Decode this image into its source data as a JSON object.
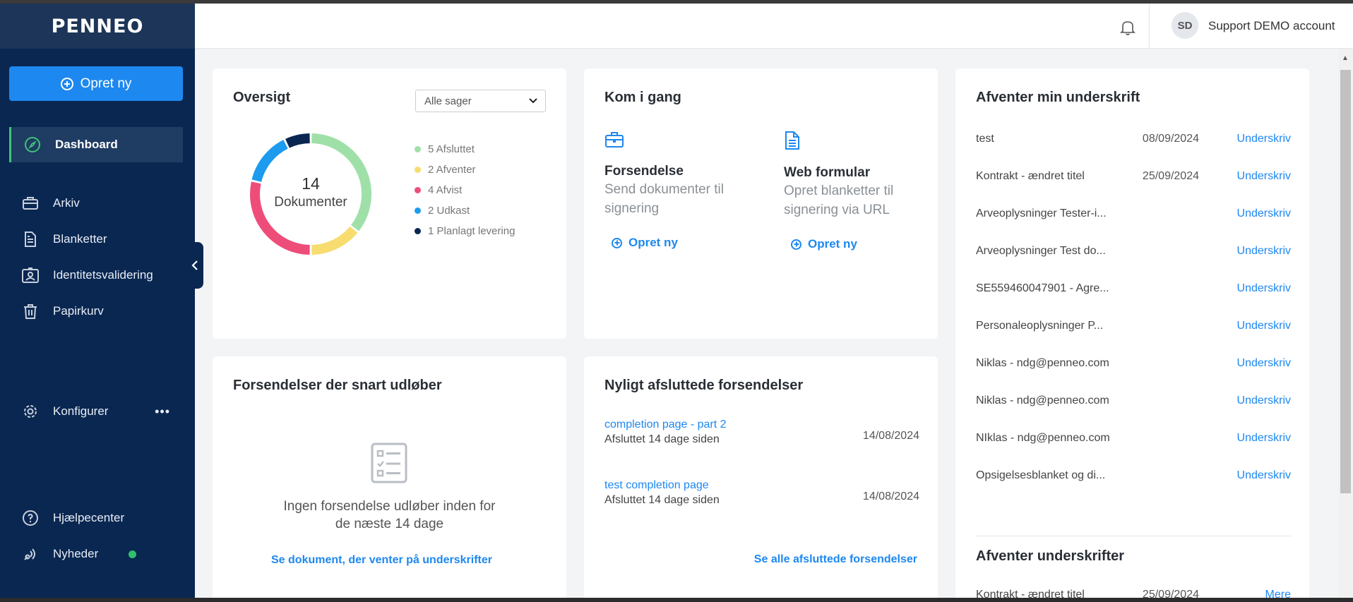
{
  "app": {
    "logo": "PENNEO"
  },
  "sidebar": {
    "create_label": "Opret ny",
    "items": [
      {
        "label": "Dashboard",
        "icon": "compass-icon"
      },
      {
        "label": "Arkiv",
        "icon": "briefcase-icon"
      },
      {
        "label": "Blanketter",
        "icon": "document-icon"
      },
      {
        "label": "Identitetsvalidering",
        "icon": "id-badge-icon"
      },
      {
        "label": "Papirkurv",
        "icon": "trash-icon"
      },
      {
        "label": "Konfigurer",
        "icon": "gear-icon"
      },
      {
        "label": "Hjælpecenter",
        "icon": "help-icon"
      },
      {
        "label": "Nyheder",
        "icon": "broadcast-icon"
      }
    ],
    "more": "•••"
  },
  "header": {
    "avatar_initials": "SD",
    "account_name": "Support DEMO account"
  },
  "overview": {
    "title": "Oversigt",
    "filter_value": "Alle sager",
    "total": "14",
    "total_label": "Dokumenter",
    "legend": [
      {
        "label": "5 Afsluttet",
        "color": "#9fe0a8"
      },
      {
        "label": "2 Afventer",
        "color": "#f7dc6f"
      },
      {
        "label": "4 Afvist",
        "color": "#ee4d7a"
      },
      {
        "label": "2 Udkast",
        "color": "#1c9bef"
      },
      {
        "label": "1 Planlagt levering",
        "color": "#0a2752"
      }
    ]
  },
  "chart_data": {
    "type": "pie",
    "categories": [
      "Afsluttet",
      "Afventer",
      "Afvist",
      "Udkast",
      "Planlagt levering"
    ],
    "values": [
      5,
      2,
      4,
      2,
      1
    ],
    "colors": [
      "#9fe0a8",
      "#f7dc6f",
      "#ee4d7a",
      "#1c9bef",
      "#0a2752"
    ],
    "title": "Oversigt"
  },
  "getting_started": {
    "title": "Kom i gang",
    "cols": [
      {
        "title": "Forsendelse",
        "desc1": "Send dokumenter til",
        "desc2": "signering",
        "action": "Opret ny"
      },
      {
        "title": "Web formular",
        "desc1": "Opret blanketter til",
        "desc2": "signering via URL",
        "action": "Opret ny"
      }
    ]
  },
  "awaiting_my_signature": {
    "title": "Afventer min underskrift",
    "rows": [
      {
        "name": "test",
        "date": "08/09/2024",
        "action": "Underskriv"
      },
      {
        "name": "Kontrakt - ændret titel",
        "date": "25/09/2024",
        "action": "Underskriv"
      },
      {
        "name": "Arveoplysninger Tester-i...",
        "date": "",
        "action": "Underskriv"
      },
      {
        "name": "Arveoplysninger Test do...",
        "date": "",
        "action": "Underskriv"
      },
      {
        "name": "SE559460047901 - Agre...",
        "date": "",
        "action": "Underskriv"
      },
      {
        "name": "Personaleoplysninger P...",
        "date": "",
        "action": "Underskriv"
      },
      {
        "name": "Niklas - ndg@penneo.com",
        "date": "",
        "action": "Underskriv"
      },
      {
        "name": "Niklas - ndg@penneo.com",
        "date": "",
        "action": "Underskriv"
      },
      {
        "name": "NIklas - ndg@penneo.com",
        "date": "",
        "action": "Underskriv"
      },
      {
        "name": "Opsigelsesblanket og di...",
        "date": "",
        "action": "Underskriv"
      }
    ],
    "second_title": "Afventer underskrifter",
    "second_row": {
      "name": "Kontrakt - ændret titel",
      "date": "25/09/2024",
      "action": "Mere"
    }
  },
  "expiring": {
    "title": "Forsendelser der snart udløber",
    "empty_line1": "Ingen forsendelse udløber inden for",
    "empty_line2": "de næste 14 dage",
    "link": "Se dokument, der venter på underskrifter"
  },
  "recent": {
    "title": "Nyligt afsluttede forsendelser",
    "items": [
      {
        "name": "completion page - part 2",
        "sub": "Afsluttet 14 dage siden",
        "date": "14/08/2024"
      },
      {
        "name": "test completion page",
        "sub": "Afsluttet 14 dage siden",
        "date": "14/08/2024"
      }
    ],
    "link": "Se alle afsluttede forsendelser"
  }
}
